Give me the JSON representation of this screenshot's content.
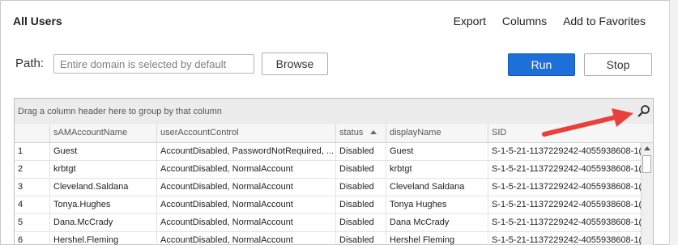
{
  "header": {
    "title": "All Users",
    "links": {
      "export": "Export",
      "columns": "Columns",
      "favorites": "Add to Favorites"
    }
  },
  "query": {
    "path_label": "Path:",
    "path_placeholder": "Entire domain is selected by default",
    "path_value": "",
    "browse_label": "Browse",
    "run_label": "Run",
    "stop_label": "Stop"
  },
  "grid": {
    "group_hint": "Drag a column header here to group by that column",
    "sorted_column": "status",
    "sort_direction": "ascending",
    "columns": [
      "",
      "sAMAccountName",
      "userAccountControl",
      "status",
      "displayName",
      "SID"
    ],
    "rows": [
      [
        "1",
        "Guest",
        "AccountDisabled, PasswordNotRequired, ...",
        "Disabled",
        "Guest",
        "S-1-5-21-1137229242-4055938608-1("
      ],
      [
        "2",
        "krbtgt",
        "AccountDisabled, NormalAccount",
        "Disabled",
        "krbtgt",
        "S-1-5-21-1137229242-4055938608-1("
      ],
      [
        "3",
        "Cleveland.Saldana",
        "AccountDisabled, NormalAccount",
        "Disabled",
        "Cleveland Saldana",
        "S-1-5-21-1137229242-4055938608-1("
      ],
      [
        "4",
        "Tonya.Hughes",
        "AccountDisabled, NormalAccount",
        "Disabled",
        "Tonya Hughes",
        "S-1-5-21-1137229242-4055938608-1("
      ],
      [
        "5",
        "Dana.McCrady",
        "AccountDisabled, NormalAccount",
        "Disabled",
        "Dana McCrady",
        "S-1-5-21-1137229242-4055938608-1("
      ],
      [
        "6",
        "Hershel.Fleming",
        "AccountDisabled, NormalAccount",
        "Disabled",
        "Hershel Fleming",
        "S-1-5-21-1137229242-4055938608-1("
      ]
    ]
  },
  "icons": {
    "search": "search-icon",
    "sort": "sort-ascending-icon",
    "annotation": "red-arrow"
  },
  "colors": {
    "run_button": "#1f6fd8",
    "annotation_arrow": "#e8413c",
    "group_bar": "#ececec"
  }
}
